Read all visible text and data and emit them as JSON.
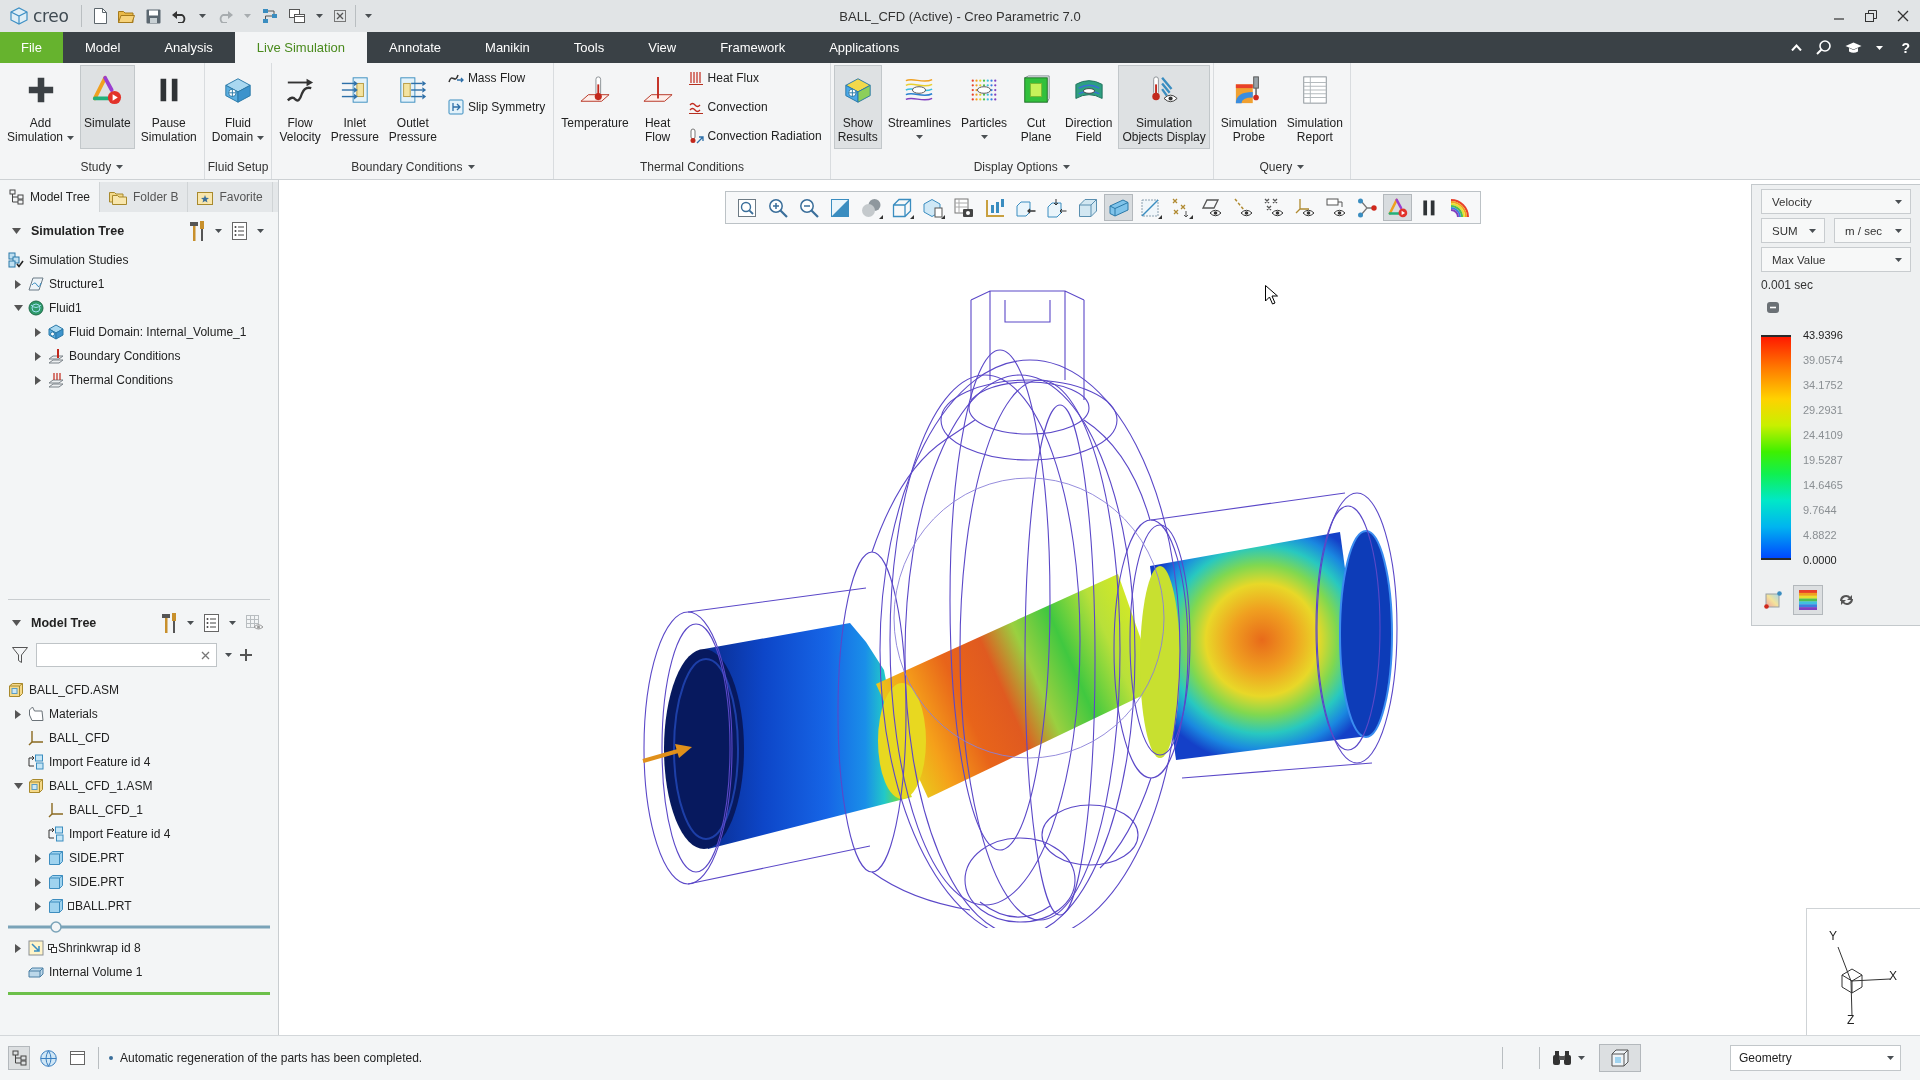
{
  "title_bar": {
    "logo": "creo",
    "title": "BALL_CFD (Active) - Creo Parametric 7.0"
  },
  "menu_bar": {
    "tabs": [
      {
        "label": "File",
        "kind": "file",
        "selected": false
      },
      {
        "label": "Model",
        "kind": "tab",
        "selected": false
      },
      {
        "label": "Analysis",
        "kind": "tab",
        "selected": false
      },
      {
        "label": "Live Simulation",
        "kind": "tab",
        "selected": true
      },
      {
        "label": "Annotate",
        "kind": "tab",
        "selected": false
      },
      {
        "label": "Manikin",
        "kind": "tab",
        "selected": false
      },
      {
        "label": "Tools",
        "kind": "tab",
        "selected": false
      },
      {
        "label": "View",
        "kind": "tab",
        "selected": false
      },
      {
        "label": "Framework",
        "kind": "tab",
        "selected": false
      },
      {
        "label": "Applications",
        "kind": "tab",
        "selected": false
      }
    ],
    "help": "?"
  },
  "ribbon": {
    "groups": [
      {
        "label": "Study",
        "menu": true,
        "items": [
          {
            "kind": "large",
            "label": "Add\nSimulation",
            "menu": true,
            "selected": false
          },
          {
            "kind": "large",
            "label": "Simulate",
            "selected": true
          },
          {
            "kind": "large",
            "label": "Pause\nSimulation",
            "selected": false
          }
        ]
      },
      {
        "label": "Fluid Setup",
        "menu": false,
        "items": [
          {
            "kind": "large",
            "label": "Fluid\nDomain",
            "menu": true,
            "selected": false
          }
        ]
      },
      {
        "label": "Boundary Conditions",
        "menu": true,
        "items": [
          {
            "kind": "large",
            "label": "Flow\nVelocity",
            "selected": false
          },
          {
            "kind": "large",
            "label": "Inlet\nPressure",
            "selected": false
          },
          {
            "kind": "large",
            "label": "Outlet\nPressure",
            "selected": false
          },
          {
            "kind": "small",
            "label": "Mass Flow",
            "selected": false
          },
          {
            "kind": "small",
            "label": "Slip Symmetry",
            "selected": false
          }
        ]
      },
      {
        "label": "Thermal Conditions",
        "menu": false,
        "items": [
          {
            "kind": "large",
            "label": "Temperature",
            "selected": false
          },
          {
            "kind": "large",
            "label": "Heat\nFlow",
            "selected": false
          },
          {
            "kind": "small",
            "label": "Heat Flux",
            "selected": false
          },
          {
            "kind": "small",
            "label": "Convection",
            "selected": false
          },
          {
            "kind": "small",
            "label": "Convection Radiation",
            "selected": false
          }
        ]
      },
      {
        "label": "Display Options",
        "menu": true,
        "items": [
          {
            "kind": "large",
            "label": "Show\nResults",
            "selected": true
          },
          {
            "kind": "large",
            "label": "Streamlines",
            "menu": true,
            "selected": false
          },
          {
            "kind": "large",
            "label": "Particles",
            "menu": true,
            "selected": false
          },
          {
            "kind": "large",
            "label": "Cut\nPlane",
            "selected": false
          },
          {
            "kind": "large",
            "label": "Direction\nField",
            "selected": false
          },
          {
            "kind": "large",
            "label": "Simulation\nObjects Display",
            "selected": true
          }
        ]
      },
      {
        "label": "Query",
        "menu": true,
        "items": [
          {
            "kind": "large",
            "label": "Simulation\nProbe",
            "selected": false
          },
          {
            "kind": "large",
            "label": "Simulation\nReport",
            "selected": false
          }
        ]
      }
    ]
  },
  "left_panel": {
    "tabs": [
      {
        "label": "Model Tree",
        "selected": true
      },
      {
        "label": "Folder B",
        "selected": false
      },
      {
        "label": "Favorite",
        "selected": false
      }
    ],
    "simulation_tree": {
      "title": "Simulation Tree",
      "expanded": true,
      "items": [
        {
          "label": "Simulation Studies",
          "kind": "studies",
          "children": [
            {
              "label": "Structure1",
              "kind": "structure",
              "expanded": false
            },
            {
              "label": "Fluid1",
              "kind": "fluid",
              "expanded": true,
              "children": [
                {
                  "label": "Fluid Domain: Internal_Volume_1",
                  "kind": "fluid-domain",
                  "expanded": false
                },
                {
                  "label": "Boundary Conditions",
                  "kind": "boundary-conditions",
                  "expanded": false
                },
                {
                  "label": "Thermal Conditions",
                  "kind": "thermal-conditions",
                  "expanded": false
                }
              ]
            }
          ]
        }
      ]
    },
    "model_tree": {
      "title": "Model Tree",
      "expanded": true,
      "items": [
        {
          "label": "BALL_CFD.ASM",
          "kind": "assembly",
          "children": [
            {
              "label": "Materials",
              "kind": "materials",
              "expanded": false
            },
            {
              "label": "BALL_CFD",
              "kind": "csys"
            },
            {
              "label": "Import Feature id 4",
              "kind": "import-feature"
            },
            {
              "label": "BALL_CFD_1.ASM",
              "kind": "assembly",
              "expanded": true,
              "children": [
                {
                  "label": "BALL_CFD_1",
                  "kind": "csys"
                },
                {
                  "label": "Import Feature id 4",
                  "kind": "import-feature"
                },
                {
                  "label": "SIDE.PRT",
                  "kind": "part",
                  "expanded": false
                },
                {
                  "label": "SIDE.PRT",
                  "kind": "part",
                  "expanded": false
                },
                {
                  "label": "BALL.PRT",
                  "kind": "part",
                  "expanded": false,
                  "flagged": true
                }
              ]
            },
            {
              "kind": "insert-marker"
            },
            {
              "label": "Shrinkwrap id 8",
              "kind": "shrinkwrap",
              "expanded": false,
              "flagged": true
            },
            {
              "label": "Internal Volume 1",
              "kind": "volume"
            }
          ]
        }
      ]
    }
  },
  "viewport": {
    "toolbar": [
      {
        "selected": false
      },
      {
        "selected": false
      },
      {
        "selected": false
      },
      {
        "selected": false
      },
      {
        "selected": false,
        "menu": true
      },
      {
        "selected": false,
        "menu": true
      },
      {
        "selected": false,
        "menu": true
      },
      {
        "selected": false
      },
      {
        "selected": false
      },
      {
        "selected": false
      },
      {
        "selected": false
      },
      {
        "selected": false
      },
      {
        "selected": true
      },
      {
        "selected": false,
        "menu": true
      },
      {
        "selected": false,
        "menu": true
      },
      {
        "selected": false
      },
      {
        "selected": false
      },
      {
        "selected": false
      },
      {
        "selected": false
      },
      {
        "selected": false
      },
      {
        "selected": false
      },
      {
        "selected": true
      },
      {
        "selected": false
      },
      {
        "selected": false
      }
    ],
    "axes": [
      {
        "label": "Y",
        "kind": "y"
      },
      {
        "label": "X",
        "kind": "x"
      },
      {
        "label": "Z",
        "kind": "z"
      }
    ]
  },
  "legend": {
    "quantity": "Velocity",
    "combine": "SUM",
    "units": "m / sec",
    "mode": "Max Value",
    "time": "0.001 sec",
    "labels": [
      {
        "text": "43.9396",
        "kind": "limit"
      },
      {
        "text": "39.0574",
        "kind": "step"
      },
      {
        "text": "34.1752",
        "kind": "step"
      },
      {
        "text": "29.2931",
        "kind": "step"
      },
      {
        "text": "24.4109",
        "kind": "step"
      },
      {
        "text": "19.5287",
        "kind": "step"
      },
      {
        "text": "14.6465",
        "kind": "step"
      },
      {
        "text": "9.7644",
        "kind": "step"
      },
      {
        "text": "4.8822",
        "kind": "step"
      },
      {
        "text": "0.0000",
        "kind": "limit"
      }
    ],
    "tools": [
      {
        "selected": false
      },
      {
        "selected": true
      },
      {
        "selected": false
      }
    ]
  },
  "status_bar": {
    "tools": [
      {
        "selected": true
      },
      {
        "selected": false
      },
      {
        "selected": false
      }
    ],
    "message": "Automatic regeneration of the parts has been completed.",
    "filter": "Geometry"
  }
}
